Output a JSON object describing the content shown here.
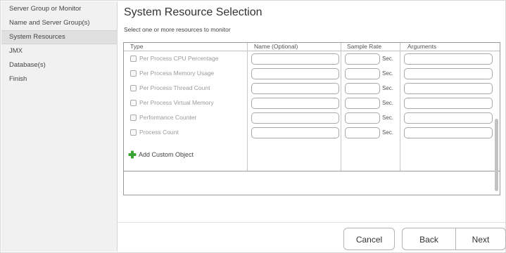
{
  "sidebar": {
    "items": [
      {
        "label": "Server Group or Monitor"
      },
      {
        "label": "Name and Server Group(s)"
      },
      {
        "label": "System Resources"
      },
      {
        "label": "JMX"
      },
      {
        "label": "Database(s)"
      },
      {
        "label": "Finish"
      }
    ],
    "active_index": 2
  },
  "main": {
    "title": "System Resource Selection",
    "subtitle": "Select one or more resources to monitor"
  },
  "table": {
    "headers": {
      "type": "Type",
      "name": "Name (Optional)",
      "sample_rate": "Sample Rate",
      "arguments": "Arguments"
    },
    "rows": [
      {
        "type": "Per Process CPU Percentage",
        "name": "",
        "rate": "",
        "unit": "Sec.",
        "args": "",
        "checked": false
      },
      {
        "type": "Per Process Memory Usage",
        "name": "",
        "rate": "",
        "unit": "Sec.",
        "args": "",
        "checked": false
      },
      {
        "type": "Per Process Thread Count",
        "name": "",
        "rate": "",
        "unit": "Sec.",
        "args": "",
        "checked": false
      },
      {
        "type": "Per Process Virtual Memory",
        "name": "",
        "rate": "",
        "unit": "Sec.",
        "args": "",
        "checked": false
      },
      {
        "type": "Performance Counter",
        "name": "",
        "rate": "",
        "unit": "Sec.",
        "args": "",
        "checked": false
      },
      {
        "type": "Process Count",
        "name": "",
        "rate": "",
        "unit": "Sec.",
        "args": "",
        "checked": false
      }
    ],
    "add_custom_label": "Add Custom Object"
  },
  "footer": {
    "cancel_label": "Cancel",
    "back_label": "Back",
    "next_label": "Next"
  },
  "colors": {
    "sidebar_bg": "#f1f1f1",
    "active_item_bg": "#e0e0e0",
    "plus_icon": "#3aa335"
  }
}
